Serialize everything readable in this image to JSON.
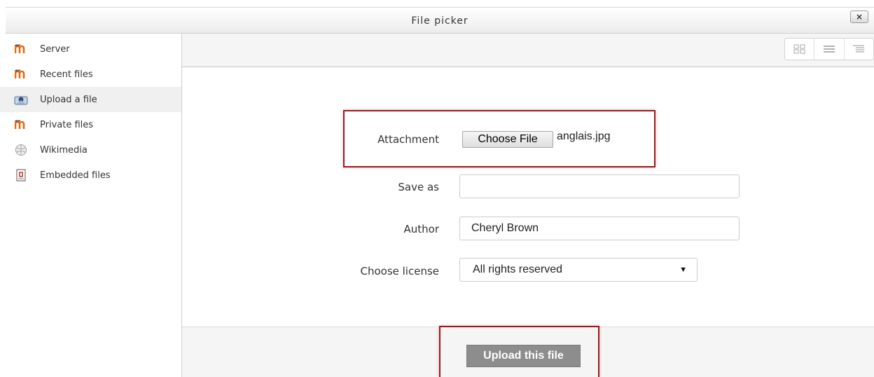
{
  "dialog": {
    "title": "File picker",
    "close_label": "×"
  },
  "sidebar": {
    "items": [
      {
        "label": "Server",
        "icon": "moodle-icon"
      },
      {
        "label": "Recent files",
        "icon": "moodle-icon"
      },
      {
        "label": "Upload a file",
        "icon": "upload-icon"
      },
      {
        "label": "Private files",
        "icon": "moodle-icon"
      },
      {
        "label": "Wikimedia",
        "icon": "wikimedia-icon"
      },
      {
        "label": "Embedded files",
        "icon": "embedded-files-icon"
      }
    ]
  },
  "toolbar": {
    "view_icons": [
      "grid-view-icon",
      "list-view-icon",
      "tree-view-icon"
    ]
  },
  "form": {
    "attachment_label": "Attachment",
    "choose_file_label": "Choose File",
    "selected_file": "anglais.jpg",
    "save_as_label": "Save as",
    "save_as_value": "",
    "author_label": "Author",
    "author_value": "Cheryl Brown",
    "license_label": "Choose license",
    "license_value": "All rights reserved",
    "license_arrow": "▼"
  },
  "footer": {
    "upload_label": "Upload this file"
  },
  "colors": {
    "highlight": "#a4161a",
    "moodle_orange": "#e8670d",
    "upload_button": "#8d8d8d"
  }
}
